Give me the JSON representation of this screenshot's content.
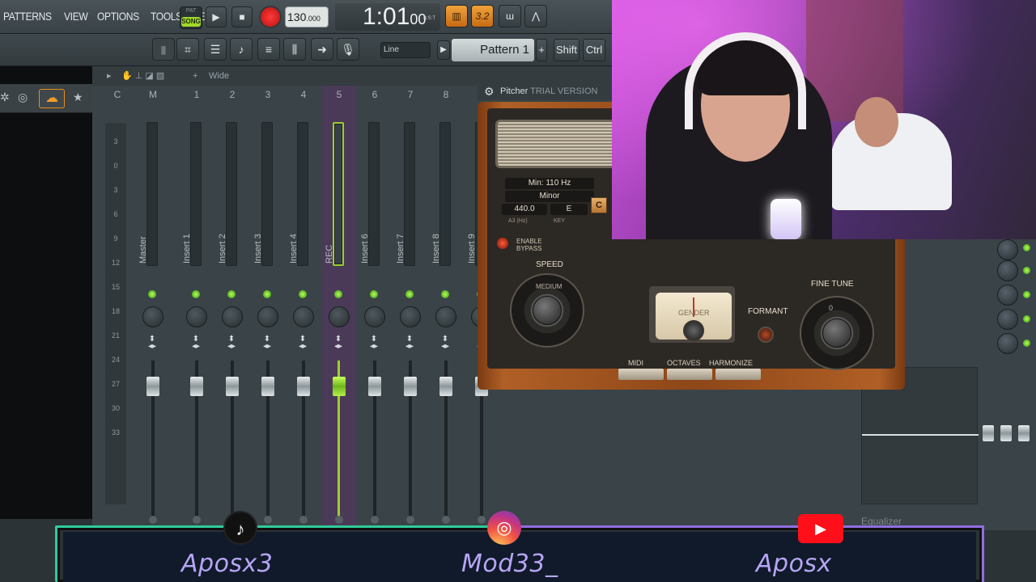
{
  "menu": [
    "PATTERNS",
    "VIEW",
    "OPTIONS",
    "TOOLS",
    "HELP"
  ],
  "transport": {
    "pat_label": "PAT",
    "song_label": "SONG",
    "play_icon": "play-icon",
    "stop_icon": "stop-icon",
    "record_icon": "record-icon",
    "tempo_main": "130",
    "tempo_frac": ".000",
    "time_main": "1:01",
    "time_sub": "00",
    "time_unit": "B:S:T"
  },
  "toolbar2": {
    "line_mode": "Line",
    "pattern": "Pattern 1",
    "plus": "+",
    "shift": "Shift",
    "ctrl": "Ctrl"
  },
  "mixer": {
    "head_wide": "Wide",
    "head_plus": "+",
    "tracks": [
      {
        "num": "C",
        "name": ""
      },
      {
        "num": "M",
        "name": "Master"
      },
      {
        "num": "1",
        "name": "Insert 1"
      },
      {
        "num": "2",
        "name": "Insert 2"
      },
      {
        "num": "3",
        "name": "Insert 3"
      },
      {
        "num": "4",
        "name": "Insert 4"
      },
      {
        "num": "5",
        "name": "REC"
      },
      {
        "num": "6",
        "name": "Insert 6"
      },
      {
        "num": "7",
        "name": "Insert 7"
      },
      {
        "num": "8",
        "name": "Insert 8"
      },
      {
        "num": "9",
        "name": "Insert 9"
      }
    ],
    "db_scale": [
      "3",
      "0",
      "3",
      "6",
      "9",
      "12",
      "15",
      "18",
      "21",
      "24",
      "27",
      "30",
      "33"
    ]
  },
  "plugin": {
    "title": "Pitcher",
    "trial": "TRIAL VERSION",
    "min_freq": "Min: 110 Hz",
    "scale": "Minor",
    "a3_value": "440.0",
    "key": "E",
    "key_button": "C",
    "a3_label": "A3 (Hz)",
    "key_label": "KEY",
    "enable": "ENABLE",
    "bypass": "BYPASS",
    "speed": "SPEED",
    "speed_medium": "MEDIUM",
    "gender": "GENDER",
    "formant": "FORMANT",
    "fine_tune": "FINE TUNE",
    "fine_zero": "0",
    "midi": "MIDI",
    "octaves": "OCTAVES",
    "harmonize": "HARMONIZE"
  },
  "right": {
    "equalizer": "Equalizer"
  },
  "social": [
    {
      "name": "Aposx3",
      "icon": "tiktok-icon",
      "glyph": "♪"
    },
    {
      "name": "Mod33_",
      "icon": "instagram-icon",
      "glyph": "◎"
    },
    {
      "name": "Aposx",
      "icon": "youtube-icon",
      "glyph": "▶"
    }
  ]
}
